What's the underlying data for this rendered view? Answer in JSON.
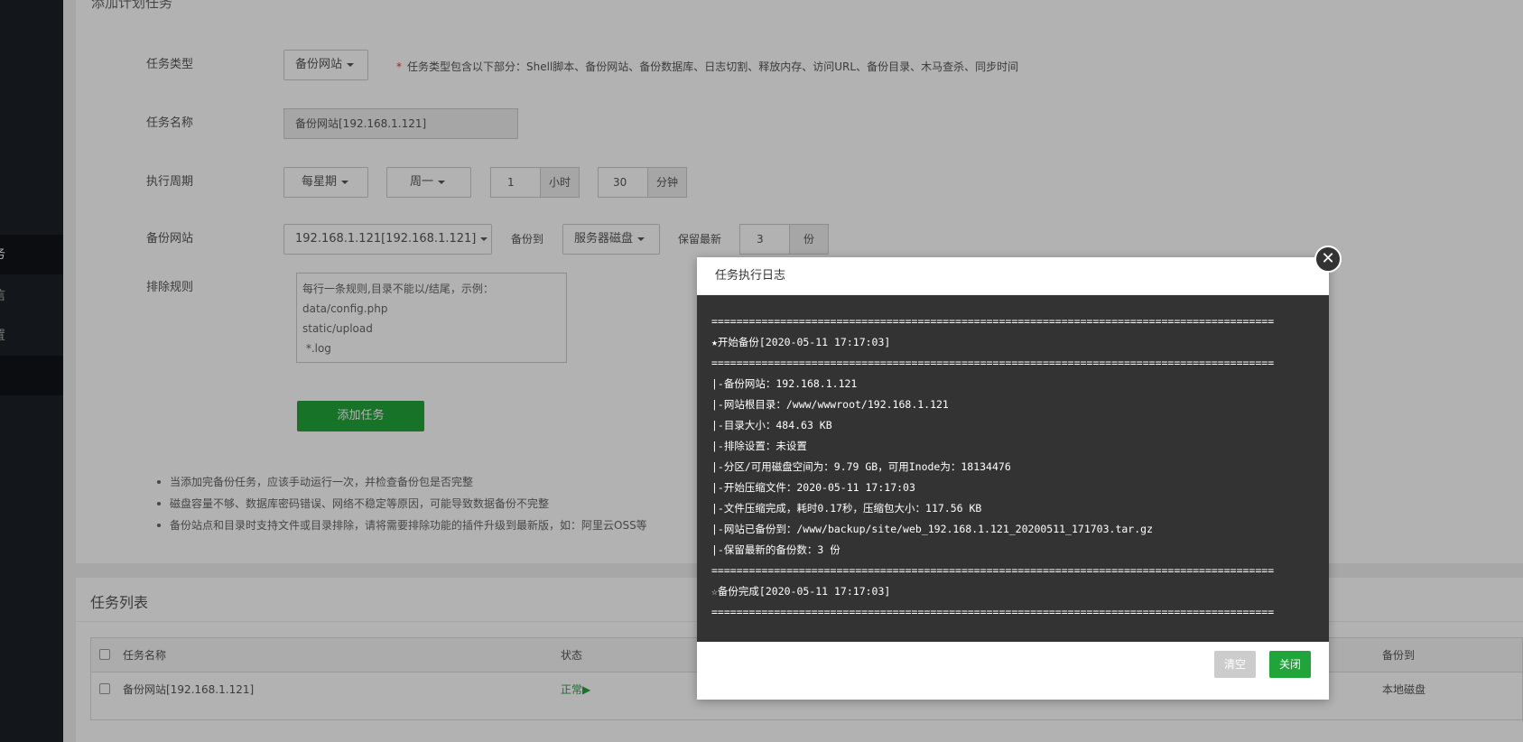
{
  "sidebar": {
    "items": [
      {
        "label": "务",
        "active": true
      },
      {
        "label": "信"
      },
      {
        "label": "置"
      }
    ]
  },
  "form": {
    "panel_title": "添加计划任务",
    "task_type": {
      "label": "任务类型",
      "value": "备份网站",
      "tip_star": "*",
      "tip": "任务类型包含以下部分：Shell脚本、备份网站、备份数据库、日志切割、释放内存、访问URL、备份目录、木马查杀、同步时间"
    },
    "task_name": {
      "label": "任务名称",
      "value": "备份网站[192.168.1.121]"
    },
    "cycle": {
      "label": "执行周期",
      "period": "每星期",
      "weekday": "周一",
      "hour": "1",
      "hour_unit": "小时",
      "minute": "30",
      "minute_unit": "分钟"
    },
    "backup_site": {
      "label": "备份网站",
      "site": "192.168.1.121[192.168.1.121]",
      "backup_to_label": "备份到",
      "backup_to": "服务器磁盘",
      "keep_label": "保留最新",
      "keep_value": "3",
      "keep_unit": "份"
    },
    "exclude": {
      "label": "排除规则",
      "lines": [
        "每行一条规则,目录不能以/结尾，示例：",
        "data/config.php",
        "static/upload",
        " *.log"
      ]
    },
    "add_button": "添加任务",
    "notes": [
      "当添加完备份任务，应该手动运行一次，并检查备份包是否完整",
      "磁盘容量不够、数据库密码错误、网络不稳定等原因，可能导致数据备份不完整",
      "备份站点和目录时支持文件或目录排除，请将需要排除功能的插件升级到最新版，如：阿里云OSS等"
    ]
  },
  "task_list": {
    "title": "任务列表",
    "headers": {
      "name": "任务名称",
      "status": "状态",
      "backup_to": "备份到"
    },
    "rows": [
      {
        "name": "备份网站[192.168.1.121]",
        "status": "正常▶",
        "backup_to": "本地磁盘"
      }
    ]
  },
  "modal": {
    "title": "任务执行日志",
    "log": [
      "==========================================================================================",
      "★开始备份[2020-05-11 17:17:03]",
      "==========================================================================================",
      "|-备份网站：192.168.1.121",
      "|-网站根目录：/www/wwwroot/192.168.1.121",
      "|-目录大小：484.63 KB",
      "|-排除设置：未设置",
      "|-分区/可用磁盘空间为：9.79 GB，可用Inode为：18134476",
      "|-开始压缩文件：2020-05-11 17:17:03",
      "|-文件压缩完成，耗时0.17秒，压缩包大小：117.56 KB",
      "|-网站已备份到：/www/backup/site/web_192.168.1.121_20200511_171703.tar.gz",
      "|-保留最新的备份数：3 份",
      "==========================================================================================",
      "☆备份完成[2020-05-11 17:17:03]",
      "=========================================================================================="
    ],
    "clear_button": "清空",
    "close_button": "关闭",
    "close_x": "✕"
  }
}
